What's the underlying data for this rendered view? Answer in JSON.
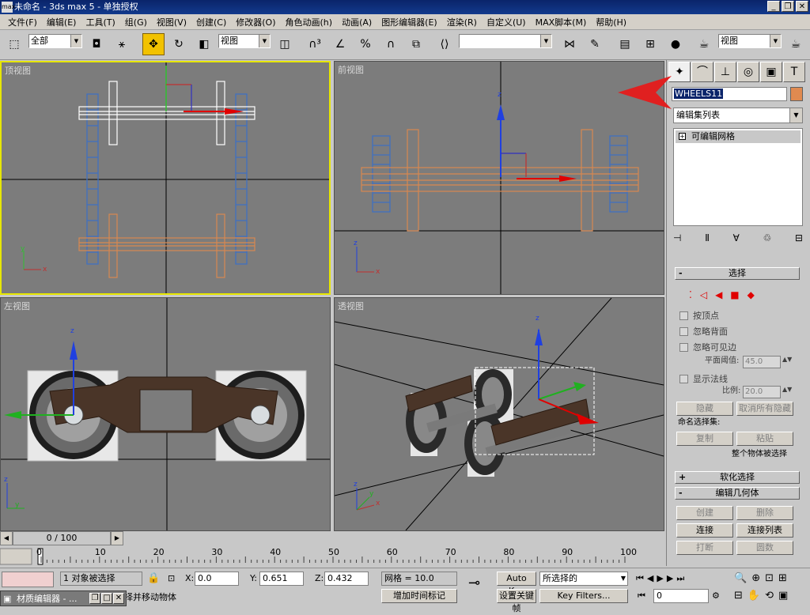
{
  "window": {
    "title": "未命名 - 3ds max 5 - 单独授权",
    "app_icon_text": "max"
  },
  "menu": [
    "文件(F)",
    "编辑(E)",
    "工具(T)",
    "组(G)",
    "视图(V)",
    "创建(C)",
    "修改器(O)",
    "角色动画(h)",
    "动画(A)",
    "图形编辑器(E)",
    "渲染(R)",
    "自定义(U)",
    "MAX脚本(M)",
    "帮助(H)"
  ],
  "toolbar": {
    "selection_filter": "全部",
    "ref_coord": "视图",
    "named_selection": "",
    "render_view": "视图"
  },
  "viewports": {
    "top": {
      "label": "顶视图"
    },
    "front": {
      "label": "前视图"
    },
    "left": {
      "label": "左视图"
    },
    "persp": {
      "label": "透视图"
    }
  },
  "axes": {
    "x": "x",
    "y": "y",
    "z": "z"
  },
  "command_panel": {
    "object_name": "WHEELS11",
    "object_color": "#e08a50",
    "modifier_list": "编辑集列表",
    "stack_item": "可编辑网格",
    "rollouts": {
      "selection": "选择",
      "soft_selection": "软化选择",
      "edit_geometry": "编辑几何体"
    },
    "selection": {
      "by_vertex": "按顶点",
      "ignore_backfaces": "忽略背面",
      "ignore_visible_edges": "忽略可见边",
      "planar_thresh_label": "平面阈值:",
      "planar_thresh": "45.0",
      "show_normals": "显示法线",
      "scale_label": "比例:",
      "scale": "20.0",
      "hide": "隐藏",
      "unhide_all": "取消所有隐藏",
      "named_sel_label": "命名选择集:",
      "copy": "复制",
      "paste": "粘贴",
      "status": "整个物体被选择"
    },
    "edit_geometry": {
      "create": "创建",
      "delete": "删除",
      "attach": "连接",
      "attach_list": "连接列表",
      "detach": "打断",
      "break": "圆数"
    }
  },
  "timeline": {
    "frame": "0 / 100",
    "ticks": [
      "0",
      "10",
      "20",
      "30",
      "40",
      "50",
      "60",
      "70",
      "80",
      "90",
      "100"
    ]
  },
  "status": {
    "selected": "1 对象被选择",
    "prompt": "单击并拖动以选择并移动物体",
    "mat_editor": "材质编辑器 - ...",
    "x_label": "X:",
    "x": "0.0",
    "y_label": "Y:",
    "y": "0.651",
    "z_label": "Z:",
    "z": "0.432",
    "grid": "网格 = 10.0",
    "add_time_tag": "增加时间标记",
    "auto_key": "Auto Key",
    "set_key": "设置关键帧",
    "key_mode": "所选择的",
    "key_filters": "Key Filters...",
    "current_frame": "0"
  }
}
